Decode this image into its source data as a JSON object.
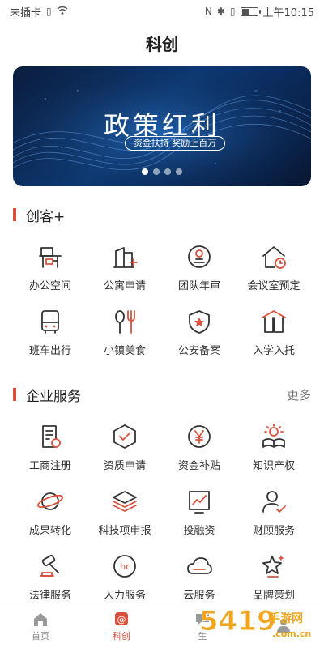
{
  "status_bar": {
    "carrier": "未插卡",
    "time": "上午10:15",
    "battery_level": 0.55
  },
  "header": {
    "title": "科创"
  },
  "banner": {
    "title": "政策红利",
    "subtitle": "资金扶持 奖励上百万",
    "slides": 4,
    "active_slide": 0
  },
  "section_chuangke": {
    "title": "创客+",
    "items": [
      {
        "label": "办公空间",
        "icon": "desk-chair-icon"
      },
      {
        "label": "公寓申请",
        "icon": "building-plus-icon"
      },
      {
        "label": "团队年审",
        "icon": "stamp-icon"
      },
      {
        "label": "会议室预定",
        "icon": "house-clock-icon"
      },
      {
        "label": "班车出行",
        "icon": "bus-icon"
      },
      {
        "label": "小镇美食",
        "icon": "fork-spoon-icon"
      },
      {
        "label": "公安备案",
        "icon": "shield-star-icon"
      },
      {
        "label": "入学入托",
        "icon": "book-house-icon"
      }
    ]
  },
  "section_enterprise": {
    "title": "企业服务",
    "more_label": "更多",
    "items": [
      {
        "label": "工商注册",
        "icon": "document-seal-icon"
      },
      {
        "label": "资质申请",
        "icon": "hexagon-check-icon"
      },
      {
        "label": "资金补贴",
        "icon": "yen-circle-icon"
      },
      {
        "label": "知识产权",
        "icon": "bulb-book-icon"
      },
      {
        "label": "成果转化",
        "icon": "planet-icon"
      },
      {
        "label": "科技项申报",
        "icon": "layers-icon"
      },
      {
        "label": "投融资",
        "icon": "chart-frame-icon"
      },
      {
        "label": "财顾服务",
        "icon": "person-check-icon"
      },
      {
        "label": "法律服务",
        "icon": "gavel-icon"
      },
      {
        "label": "人力服务",
        "icon": "hr-circle-icon"
      },
      {
        "label": "云服务",
        "icon": "cloud-icon"
      },
      {
        "label": "品牌策划",
        "icon": "star-sparkle-icon"
      }
    ]
  },
  "tabbar": {
    "tabs": [
      {
        "label": "首页",
        "icon": "home-icon"
      },
      {
        "label": "科创",
        "icon": "at-icon"
      },
      {
        "label": "生",
        "icon": "chat-icon"
      },
      {
        "label": "",
        "icon": "user-icon"
      }
    ],
    "active": 1
  },
  "watermark": {
    "text": "5419手游网",
    "url": ".com.cn"
  },
  "colors": {
    "accent": "#d9503c",
    "banner_dark": "#0b1d3d",
    "banner_light": "#0d3a74"
  }
}
